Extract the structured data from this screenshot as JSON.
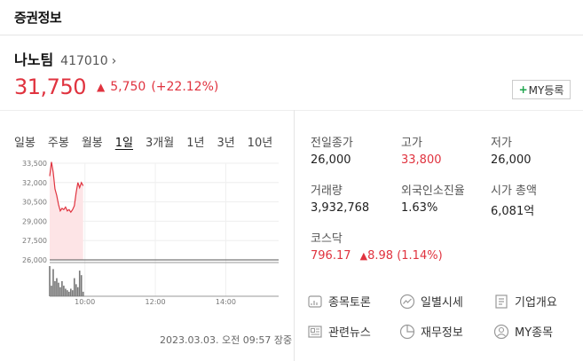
{
  "header": {
    "title": "증권정보"
  },
  "stock": {
    "name": "나노팀",
    "code": "417010",
    "price": "31,750",
    "change": "5,750",
    "change_pct": "(+22.12%)",
    "my_label": "MY등록"
  },
  "periods": [
    "일봉",
    "주봉",
    "월봉",
    "1일",
    "3개월",
    "1년",
    "3년",
    "10년"
  ],
  "active_period": "1일",
  "chart_data": {
    "type": "area",
    "yticks": [
      "33,500",
      "32,000",
      "30,500",
      "29,000",
      "27,500",
      "26,000"
    ],
    "yvalues": [
      33500,
      32000,
      30500,
      29000,
      27500,
      26000
    ],
    "ylim": [
      26000,
      33500
    ],
    "xticks": [
      "10:00",
      "12:00",
      "14:00"
    ],
    "baseline": 26000,
    "price_series": [
      {
        "t": "09:00",
        "v": 32500
      },
      {
        "t": "09:03",
        "v": 33600
      },
      {
        "t": "09:06",
        "v": 32800
      },
      {
        "t": "09:09",
        "v": 31500
      },
      {
        "t": "09:12",
        "v": 31000
      },
      {
        "t": "09:15",
        "v": 30300
      },
      {
        "t": "09:18",
        "v": 29800
      },
      {
        "t": "09:21",
        "v": 30000
      },
      {
        "t": "09:24",
        "v": 29900
      },
      {
        "t": "09:27",
        "v": 30100
      },
      {
        "t": "09:30",
        "v": 29800
      },
      {
        "t": "09:33",
        "v": 29900
      },
      {
        "t": "09:36",
        "v": 29700
      },
      {
        "t": "09:39",
        "v": 29900
      },
      {
        "t": "09:42",
        "v": 30200
      },
      {
        "t": "09:45",
        "v": 31200
      },
      {
        "t": "09:48",
        "v": 32000
      },
      {
        "t": "09:51",
        "v": 31600
      },
      {
        "t": "09:54",
        "v": 32000
      },
      {
        "t": "09:57",
        "v": 31750
      }
    ],
    "volume": [
      1.0,
      0.35,
      0.9,
      0.5,
      0.6,
      0.45,
      0.3,
      0.5,
      0.35,
      0.25,
      0.2,
      0.15,
      0.25,
      0.2,
      0.6,
      0.4,
      0.3,
      0.85,
      0.7,
      0.15
    ]
  },
  "info": {
    "prev_close_label": "전일종가",
    "prev_close": "26,000",
    "high_label": "고가",
    "high": "33,800",
    "low_label": "저가",
    "low": "26,000",
    "volume_label": "거래량",
    "volume": "3,932,768",
    "foreign_label": "외국인소진율",
    "foreign": "1.63%",
    "mcap_label": "시가 총액",
    "mcap": "6,081억",
    "kosdaq_label": "코스닥",
    "kosdaq": "796.17",
    "kosdaq_change": "8.98",
    "kosdaq_pct": "(1.14%)"
  },
  "links": {
    "discuss": "종목토론",
    "daily": "일별시세",
    "company": "기업개요",
    "news": "관련뉴스",
    "finance": "재무정보",
    "my": "MY종목"
  },
  "timestamp": "2023.03.03. 오전 09:57 장중",
  "colors": {
    "up": "#e0333f",
    "fill": "#fde4e6",
    "green": "#1aa34a"
  }
}
